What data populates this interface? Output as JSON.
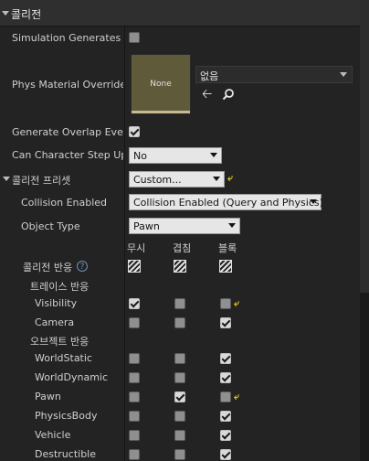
{
  "section": {
    "title": "콜리전"
  },
  "props": {
    "simulation_generates_hit": "Simulation Generates Hi",
    "phys_material_override": "Phys Material Override",
    "generate_overlap_events": "Generate Overlap Events",
    "can_character_step_up": "Can Character Step Up C",
    "collision_presets": "콜리전 프리셋",
    "collision_enabled": "Collision Enabled",
    "object_type": "Object Type"
  },
  "phys_material": {
    "thumbnail_text": "None",
    "asset_value": "없음"
  },
  "values": {
    "can_character_step_up": "No",
    "collision_presets": "Custom...",
    "collision_enabled": "Collision Enabled (Query and Physics)",
    "object_type": "Pawn"
  },
  "response_headers": {
    "ignore": "무시",
    "overlap": "겹침",
    "block": "블록"
  },
  "collision_responses": {
    "title": "콜리전 반응"
  },
  "trace_responses": {
    "title": "트레이스 반응",
    "rows": [
      {
        "label": "Visibility",
        "ignore": true,
        "overlap": false,
        "block": false,
        "reset": true
      },
      {
        "label": "Camera",
        "ignore": false,
        "overlap": false,
        "block": true,
        "reset": false
      }
    ]
  },
  "object_responses": {
    "title": "오브젝트 반응",
    "rows": [
      {
        "label": "WorldStatic",
        "ignore": false,
        "overlap": false,
        "block": true,
        "reset": false
      },
      {
        "label": "WorldDynamic",
        "ignore": false,
        "overlap": false,
        "block": true,
        "reset": false
      },
      {
        "label": "Pawn",
        "ignore": false,
        "overlap": true,
        "block": false,
        "reset": true
      },
      {
        "label": "PhysicsBody",
        "ignore": false,
        "overlap": false,
        "block": true,
        "reset": false
      },
      {
        "label": "Vehicle",
        "ignore": false,
        "overlap": false,
        "block": true,
        "reset": false
      },
      {
        "label": "Destructible",
        "ignore": false,
        "overlap": false,
        "block": true,
        "reset": false
      }
    ]
  },
  "checks": {
    "simulation_generates_hit": false,
    "generate_overlap_events": true
  },
  "icons": {
    "reset": "reset-to-default-icon",
    "help": "help-icon",
    "browse": "arrow-left-icon",
    "search": "search-icon"
  },
  "colors": {
    "background": "#232323",
    "reset_accent": "#e6c418"
  }
}
